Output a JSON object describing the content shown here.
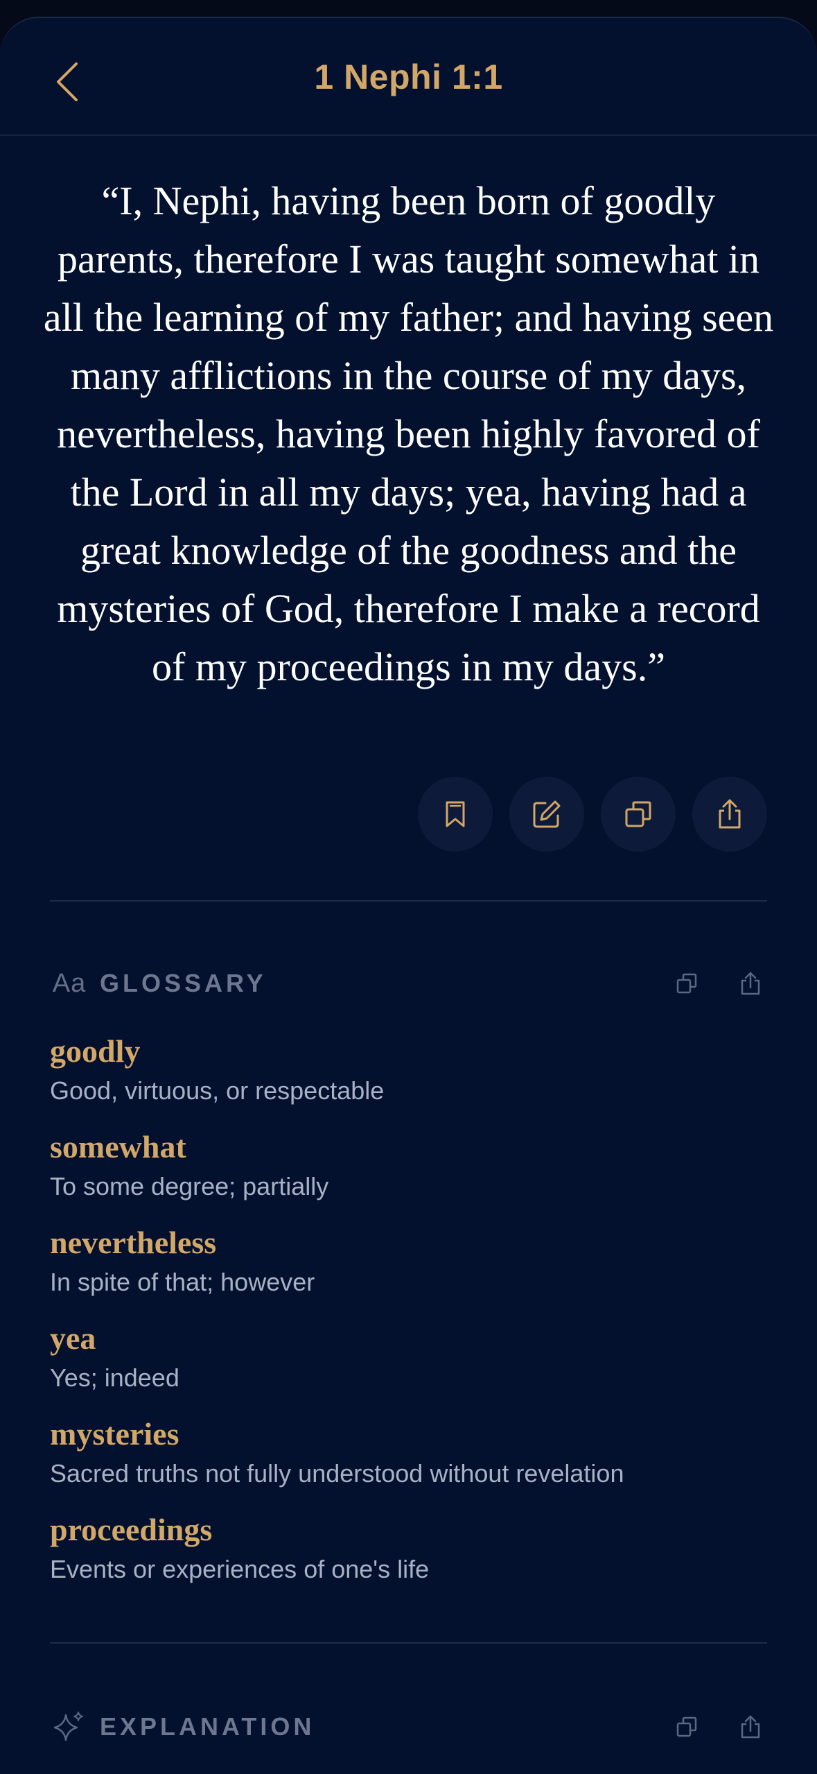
{
  "header": {
    "title": "1 Nephi 1:1"
  },
  "verse": {
    "text": "“I, Nephi, having been born of goodly parents, therefore I was taught somewhat in all the learning of my father; and having seen many afflictions in the course of my days, nevertheless, having been highly favored of the Lord in all my days; yea, having had a great knowledge of the goodness and the mysteries of God, therefore I make a record of my proceedings in my days.”"
  },
  "actions": {
    "icons": [
      "bookmark-icon",
      "edit-note-icon",
      "copy-icon",
      "share-icon"
    ]
  },
  "glossary": {
    "icon_glyph": "Aa",
    "title": "GLOSSARY",
    "items": [
      {
        "term": "goodly",
        "definition": "Good, virtuous, or respectable"
      },
      {
        "term": "somewhat",
        "definition": "To some degree; partially"
      },
      {
        "term": "nevertheless",
        "definition": "In spite of that; however"
      },
      {
        "term": "yea",
        "definition": "Yes; indeed"
      },
      {
        "term": "mysteries",
        "definition": "Sacred truths not fully understood without revelation"
      },
      {
        "term": "proceedings",
        "definition": "Events or experiences of one's life"
      }
    ]
  },
  "explanation": {
    "title": "EXPLANATION"
  },
  "colors": {
    "background": "#03112f",
    "accent": "#d3a767",
    "text": "#ffffff",
    "muted": "#6d778f",
    "definition": "#a9b2c4"
  }
}
